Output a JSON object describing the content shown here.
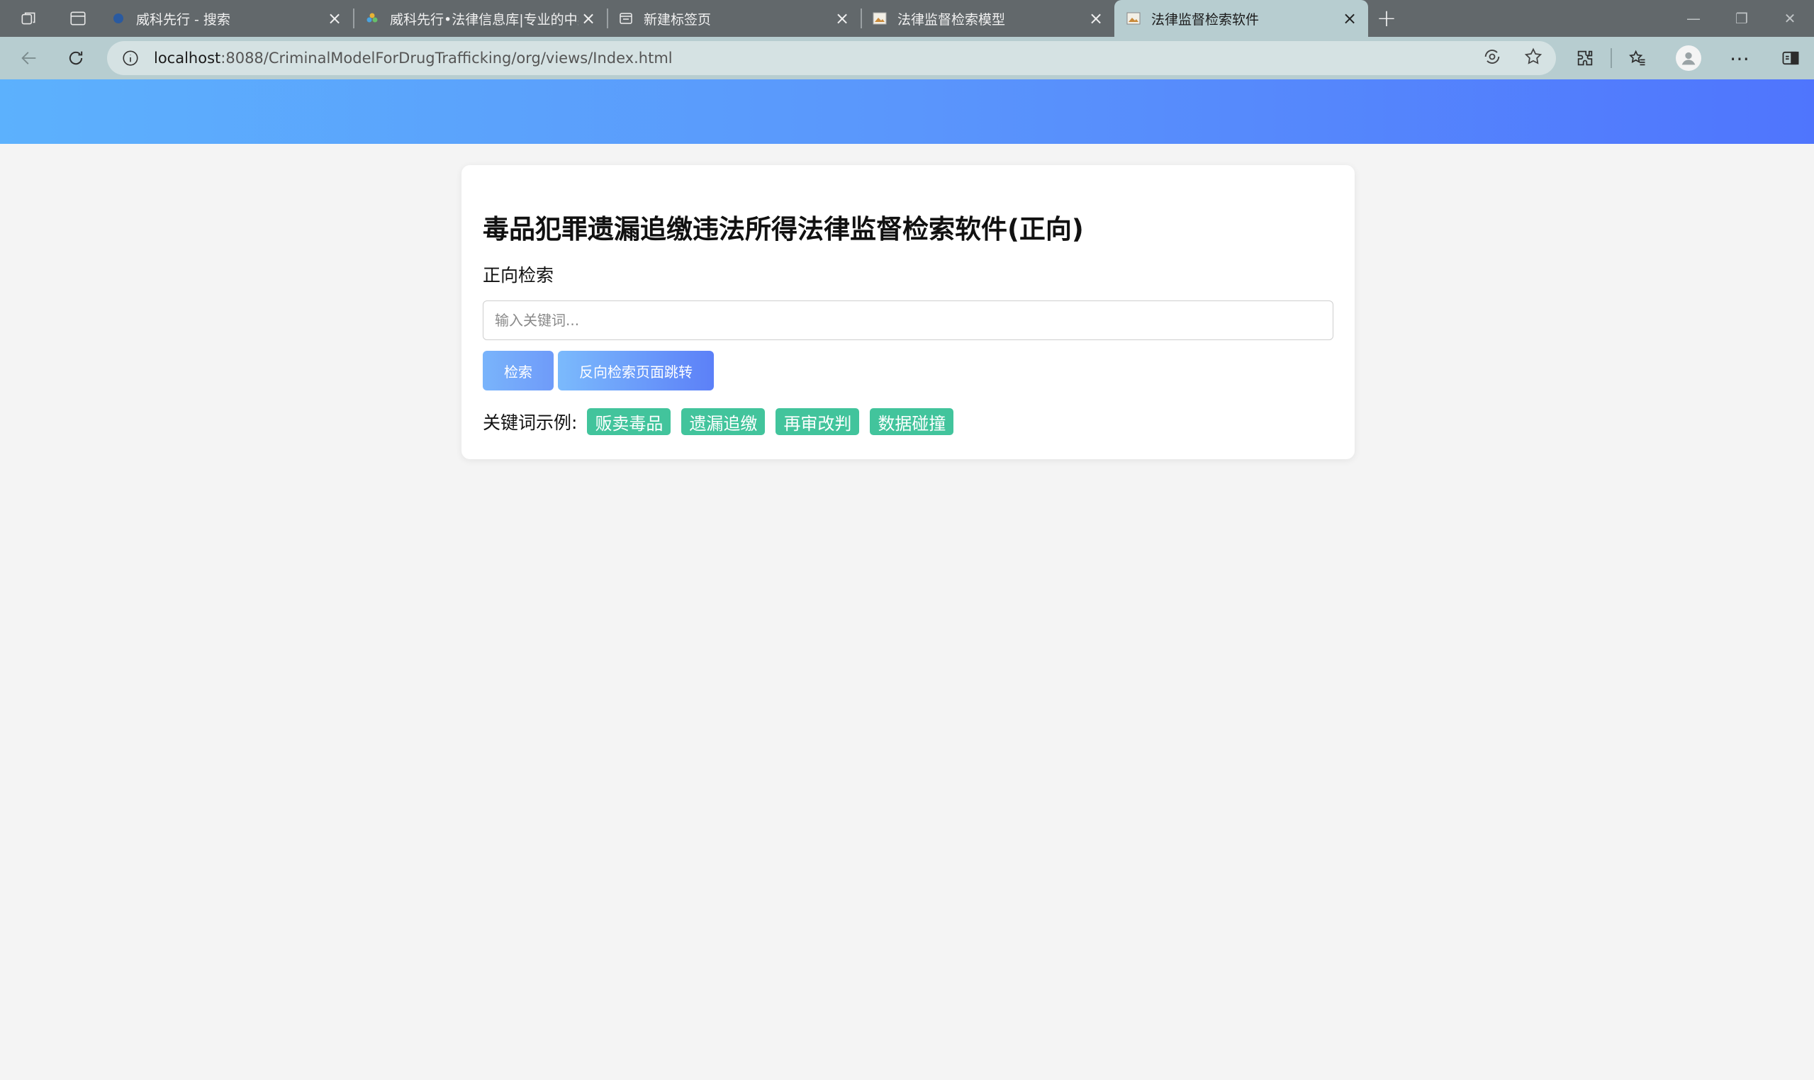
{
  "browser": {
    "tabs": [
      {
        "title": "威科先行 - 搜索",
        "favicon": "wolters-kluwer-icon",
        "active": false
      },
      {
        "title": "威科先行•法律信息库|专业的中英",
        "favicon": "flower-logo-icon",
        "active": false
      },
      {
        "title": "新建标签页",
        "favicon": "new-tab-page-icon",
        "active": false
      },
      {
        "title": "法律监督检索模型",
        "favicon": "image-favicon-icon",
        "active": false
      },
      {
        "title": "法律监督检索软件",
        "favicon": "image-favicon-icon",
        "active": true
      }
    ],
    "new_tab_symbol": "+",
    "url_host": "localhost",
    "url_rest": ":8088/CriminalModelForDrugTrafficking/org/views/Index.html"
  },
  "page": {
    "title": "毒品犯罪遗漏追缴违法所得法律监督检索软件(正向)",
    "subtitle": "正向检索",
    "search": {
      "placeholder": "输入关键词...",
      "value": ""
    },
    "buttons": {
      "search_label": "检索",
      "reverse_label": "反向检索页面跳转"
    },
    "examples": {
      "label": "关键词示例:",
      "tags": [
        "贩卖毒品",
        "遗漏追缴",
        "再审改判",
        "数据碰撞"
      ]
    }
  },
  "colors": {
    "header_gradient_start": "#5cb1fd",
    "header_gradient_end": "#4f75fd",
    "tag_green": "#42c49c",
    "button_blue": "#6f9bf9",
    "tabstrip_bg": "#62686b",
    "active_tab_bg": "#b7cdd0"
  }
}
